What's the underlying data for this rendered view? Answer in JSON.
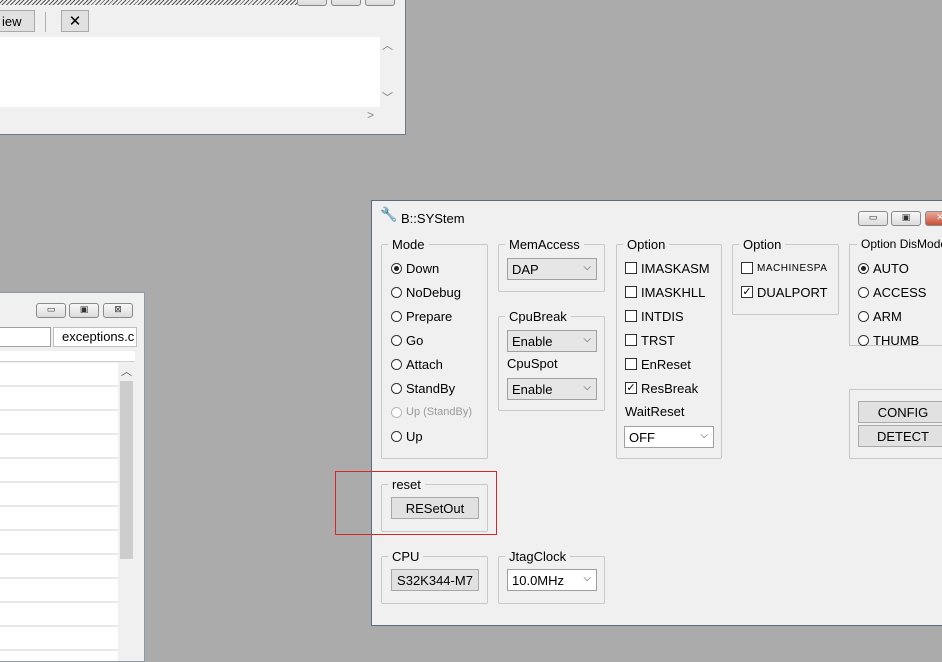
{
  "top_window": {
    "view_label": "iew",
    "tool_icon": "tools-cross-icon",
    "scroll_up": "︿",
    "scroll_down": "﹀",
    "scroll_right": ">"
  },
  "left_window": {
    "tab_label": "exceptions.c",
    "min": "▭",
    "max": "▣",
    "close": "⊠",
    "scroll_up": "︿"
  },
  "system": {
    "title": "B::SYStem",
    "title_icon": "wrench-icon",
    "min": "▭",
    "max": "▣",
    "close": "✕",
    "mode": {
      "legend": "Mode",
      "options": [
        "Down",
        "NoDebug",
        "Prepare",
        "Go",
        "Attach",
        "StandBy",
        "Up (StandBy)",
        "Up"
      ],
      "selected": "Down"
    },
    "memaccess": {
      "legend": "MemAccess",
      "value": "DAP"
    },
    "cpubreak": {
      "legend": "CpuBreak",
      "value": "Enable"
    },
    "cpuspot": {
      "legend": "CpuSpot",
      "value": "Enable"
    },
    "option1": {
      "legend": "Option",
      "items": [
        {
          "label": "IMASKASM",
          "checked": false
        },
        {
          "label": "IMASKHLL",
          "checked": false
        },
        {
          "label": "INTDIS",
          "checked": false
        },
        {
          "label": "TRST",
          "checked": false
        },
        {
          "label": "EnReset",
          "checked": false
        },
        {
          "label": "ResBreak",
          "checked": true
        }
      ]
    },
    "waitreset": {
      "legend": "WaitReset",
      "value": "OFF"
    },
    "option2": {
      "legend": "Option",
      "items": [
        {
          "label": "MACHINESPA",
          "checked": false
        },
        {
          "label": "DUALPORT",
          "checked": true
        }
      ]
    },
    "dismode": {
      "legend": "Option DisMode",
      "options": [
        "AUTO",
        "ACCESS",
        "ARM",
        "THUMB"
      ],
      "selected": "AUTO"
    },
    "config_button": "CONFIG",
    "detect_button": "DETECT",
    "reset": {
      "legend": "reset",
      "button": "RESetOut"
    },
    "cpu": {
      "legend": "CPU",
      "value": "S32K344-M7"
    },
    "jtagclock": {
      "legend": "JtagClock",
      "value": "10.0MHz"
    },
    "highlight_color": "#d9262c"
  }
}
